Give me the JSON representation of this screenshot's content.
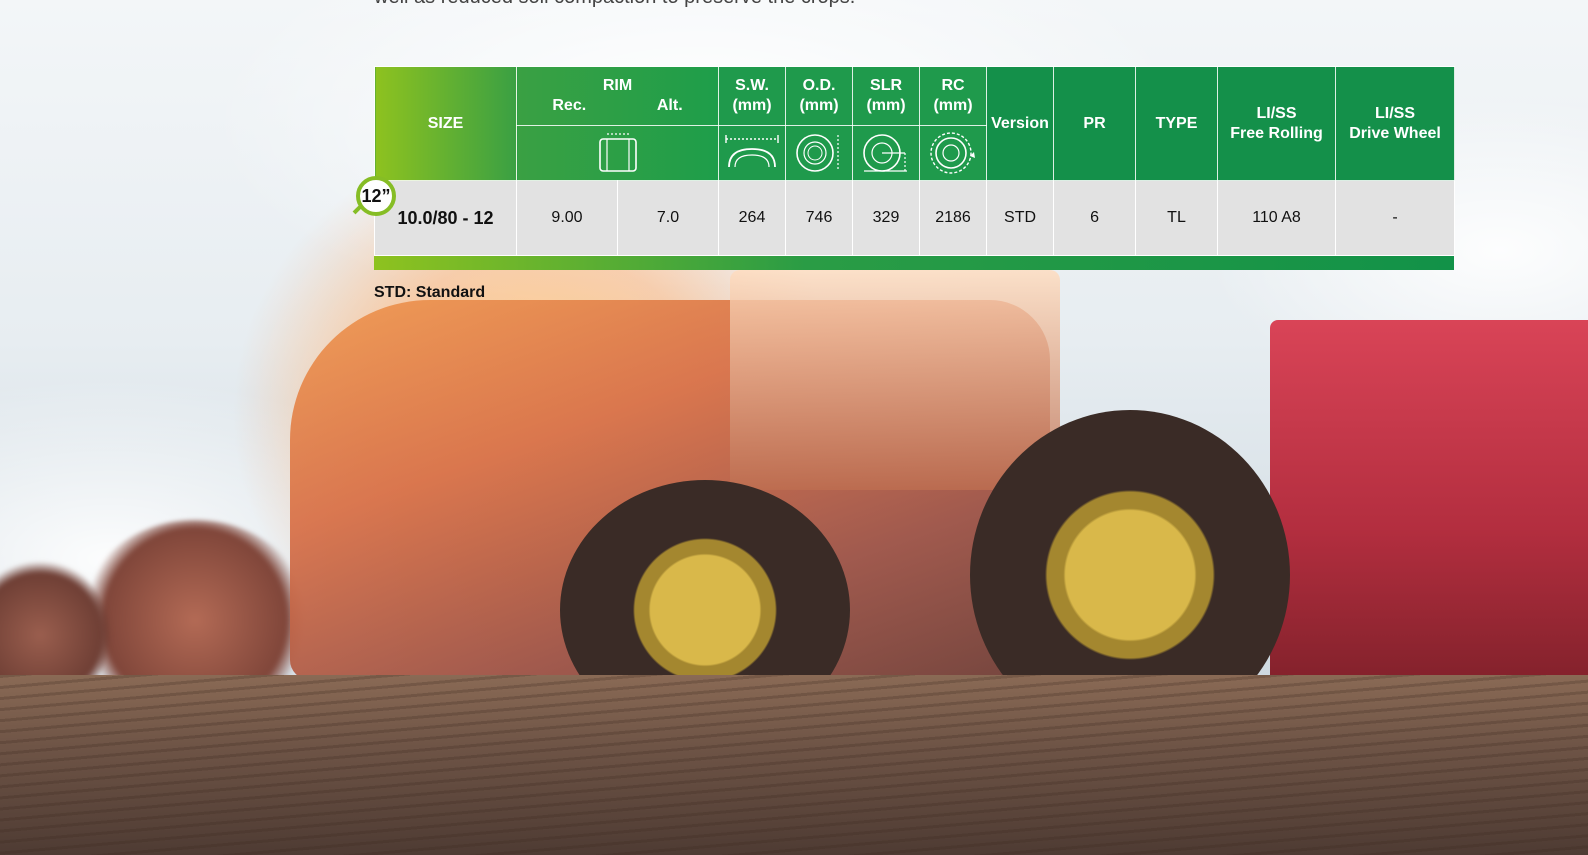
{
  "intro_text": "well as reduced soil compaction to preserve the crops.",
  "table": {
    "headers": {
      "size": "SIZE",
      "rim": "RIM",
      "rim_rec": "Rec.",
      "rim_alt": "Alt.",
      "sw": "S.W.",
      "sw_unit": "(mm)",
      "od": "O.D.",
      "od_unit": "(mm)",
      "slr": "SLR",
      "slr_unit": "(mm)",
      "rc": "RC",
      "rc_unit": "(mm)",
      "version": "Version",
      "pr": "PR",
      "type": "TYPE",
      "liss_free_1": "LI/SS",
      "liss_free_2": "Free Rolling",
      "liss_drive_1": "LI/SS",
      "liss_drive_2": "Drive Wheel"
    },
    "icons": {
      "rim": "rim-icon",
      "sw": "section-width-icon",
      "od": "outer-diameter-icon",
      "slr": "static-loaded-radius-icon",
      "rc": "rolling-circumference-icon"
    },
    "badge": "12”",
    "rows": [
      {
        "size": "10.0/80 - 12",
        "rim_rec": "9.00",
        "rim_alt": "7.0",
        "sw": "264",
        "od": "746",
        "slr": "329",
        "rc": "2186",
        "version": "STD",
        "pr": "6",
        "type": "TL",
        "liss_free": "110 A8",
        "liss_drive": "-"
      }
    ]
  },
  "note": "STD: Standard",
  "colors": {
    "green_light": "#8ec21f",
    "green_dark": "#129248",
    "row_bg": "#e2e2e2"
  }
}
